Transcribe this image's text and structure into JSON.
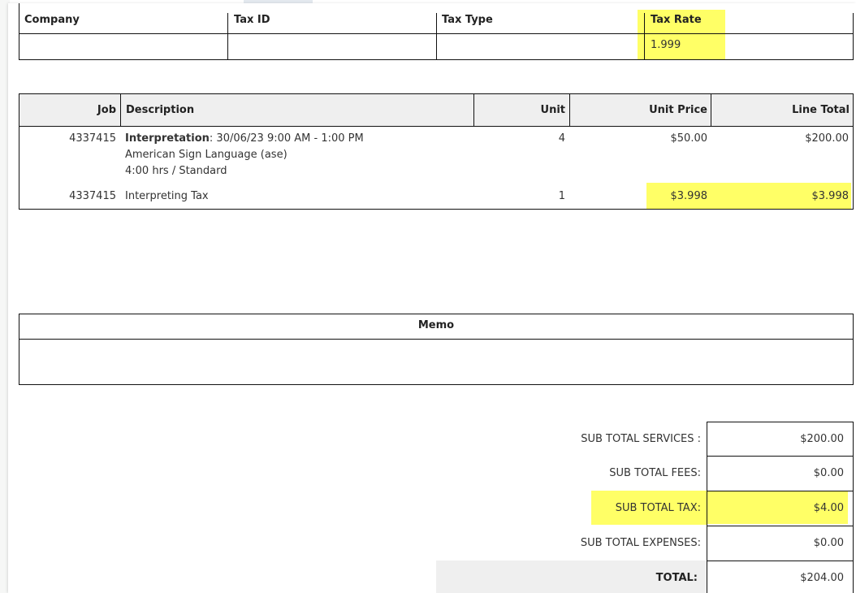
{
  "tax_table": {
    "headers": [
      "Company",
      "Tax ID",
      "Tax Type",
      "Tax Rate"
    ],
    "row": [
      "",
      "",
      "",
      "1.999"
    ]
  },
  "line_items": {
    "headers": [
      "Job",
      "Description",
      "Unit",
      "Unit Price",
      "Line Total"
    ],
    "rows": [
      {
        "job": "4337415",
        "desc_bold": "Interpretation",
        "desc_rest": ": 30/06/23 9:00 AM - 1:00 PM",
        "desc_line2": "American Sign Language (ase)",
        "desc_line3": "4:00 hrs / Standard",
        "unit": "4",
        "unit_price": "$50.00",
        "line_total": "$200.00"
      },
      {
        "job": "4337415",
        "desc": "Interpreting Tax",
        "unit": "1",
        "unit_price": "$3.998",
        "line_total": "$3.998"
      }
    ]
  },
  "memo": {
    "header": "Memo",
    "value": ""
  },
  "totals": [
    {
      "label": "SUB TOTAL SERVICES :",
      "value": "$200.00"
    },
    {
      "label": "SUB TOTAL FEES:",
      "value": "$0.00"
    },
    {
      "label": "SUB TOTAL TAX:",
      "value": "$4.00"
    },
    {
      "label": "SUB TOTAL EXPENSES:",
      "value": "$0.00"
    },
    {
      "label": "TOTAL:",
      "value": "$204.00"
    }
  ],
  "colors": {
    "highlight": "#ffff66",
    "header_bg": "#efefef",
    "border": "#111111"
  }
}
